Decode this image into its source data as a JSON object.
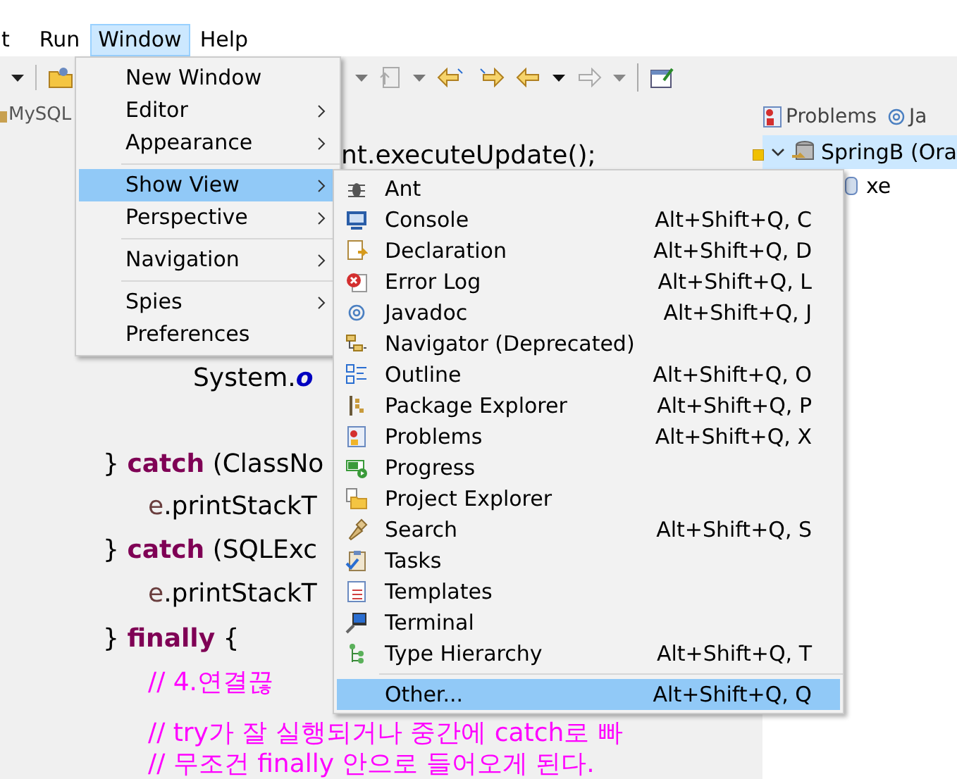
{
  "menubar": [
    {
      "label": "t",
      "selected": false
    },
    {
      "label": "Run",
      "selected": false
    },
    {
      "label": "Window",
      "selected": true
    },
    {
      "label": "Help",
      "selected": false
    }
  ],
  "editor": {
    "tab": {
      "label": "MySQL"
    },
    "lines": [
      {
        "kind": "continued",
        "segments": [
          {
            "kind": "plain",
            "text": "nt.executeUpdate();"
          }
        ]
      },
      {
        "kind": "deep",
        "segments": [
          {
            "kind": "plain",
            "text": "System."
          },
          {
            "kind": "field",
            "text": "o"
          }
        ]
      },
      {
        "kind": "outer",
        "segments": [
          {
            "kind": "plain",
            "text": "} "
          },
          {
            "kind": "keyword",
            "text": "catch"
          },
          {
            "kind": "plain",
            "text": " (ClassNo"
          }
        ]
      },
      {
        "kind": "inner",
        "segments": [
          {
            "kind": "variable",
            "text": "e"
          },
          {
            "kind": "plain",
            "text": ".printStackT"
          }
        ]
      },
      {
        "kind": "outer",
        "segments": [
          {
            "kind": "plain",
            "text": "} "
          },
          {
            "kind": "keyword",
            "text": "catch"
          },
          {
            "kind": "plain",
            "text": " (SQLExc"
          }
        ]
      },
      {
        "kind": "inner",
        "segments": [
          {
            "kind": "variable",
            "text": "e"
          },
          {
            "kind": "plain",
            "text": ".printStackT"
          }
        ]
      },
      {
        "kind": "outer",
        "segments": [
          {
            "kind": "plain",
            "text": "} "
          },
          {
            "kind": "keyword",
            "text": "finally"
          },
          {
            "kind": "plain",
            "text": " {"
          }
        ]
      },
      {
        "kind": "inner",
        "segments": [
          {
            "kind": "comment",
            "text": "// 4.연결끊"
          }
        ]
      },
      {
        "kind": "inner",
        "segments": [
          {
            "kind": "comment",
            "text": "// try가 잘 실행되거나 중간에 catch로 빠"
          }
        ]
      },
      {
        "kind": "inner",
        "segments": [
          {
            "kind": "comment",
            "text": "// 무조건 finally 안으로 들어오게 된다."
          }
        ]
      }
    ]
  },
  "side_panel": {
    "tabs": [
      {
        "label": "Problems"
      },
      {
        "label": "Ja"
      }
    ],
    "tree": [
      {
        "label": "SpringB (Ora",
        "selected": true,
        "expanded": true,
        "children": [
          {
            "label": "xe",
            "selected": false
          }
        ]
      }
    ]
  },
  "window_menu": [
    {
      "label": "New Window",
      "submenu": false,
      "selected": false,
      "separator_before": false
    },
    {
      "label": "Editor",
      "submenu": true,
      "selected": false,
      "separator_before": false
    },
    {
      "label": "Appearance",
      "submenu": true,
      "selected": false,
      "separator_before": false
    },
    {
      "label": "Show View",
      "submenu": true,
      "selected": true,
      "separator_before": true
    },
    {
      "label": "Perspective",
      "submenu": true,
      "selected": false,
      "separator_before": false
    },
    {
      "label": "Navigation",
      "submenu": true,
      "selected": false,
      "separator_before": true
    },
    {
      "label": "Spies",
      "submenu": true,
      "selected": false,
      "separator_before": true
    },
    {
      "label": "Preferences",
      "submenu": false,
      "selected": false,
      "separator_before": false
    }
  ],
  "show_view_menu": [
    {
      "label": "Ant",
      "selected": false,
      "separator_before": false
    },
    {
      "label": "Console",
      "shortcut": "Alt+Shift+Q, C",
      "selected": false,
      "separator_before": false
    },
    {
      "label": "Declaration",
      "shortcut": "Alt+Shift+Q, D",
      "selected": false,
      "separator_before": false
    },
    {
      "label": "Error Log",
      "shortcut": "Alt+Shift+Q, L",
      "selected": false,
      "separator_before": false
    },
    {
      "label": "Javadoc",
      "shortcut": "Alt+Shift+Q, J",
      "selected": false,
      "separator_before": false
    },
    {
      "label": "Navigator (Deprecated)",
      "selected": false,
      "separator_before": false
    },
    {
      "label": "Outline",
      "shortcut": "Alt+Shift+Q, O",
      "selected": false,
      "separator_before": false
    },
    {
      "label": "Package Explorer",
      "shortcut": "Alt+Shift+Q, P",
      "selected": false,
      "separator_before": false
    },
    {
      "label": "Problems",
      "shortcut": "Alt+Shift+Q, X",
      "selected": false,
      "separator_before": false
    },
    {
      "label": "Progress",
      "selected": false,
      "separator_before": false
    },
    {
      "label": "Project Explorer",
      "selected": false,
      "separator_before": false
    },
    {
      "label": "Search",
      "shortcut": "Alt+Shift+Q, S",
      "selected": false,
      "separator_before": false
    },
    {
      "label": "Tasks",
      "selected": false,
      "separator_before": false
    },
    {
      "label": "Templates",
      "selected": false,
      "separator_before": false
    },
    {
      "label": "Terminal",
      "selected": false,
      "separator_before": false
    },
    {
      "label": "Type Hierarchy",
      "shortcut": "Alt+Shift+Q, T",
      "selected": false,
      "separator_before": false
    },
    {
      "label": "Other...",
      "shortcut": "Alt+Shift+Q, Q",
      "selected": true,
      "separator_before": true
    }
  ]
}
